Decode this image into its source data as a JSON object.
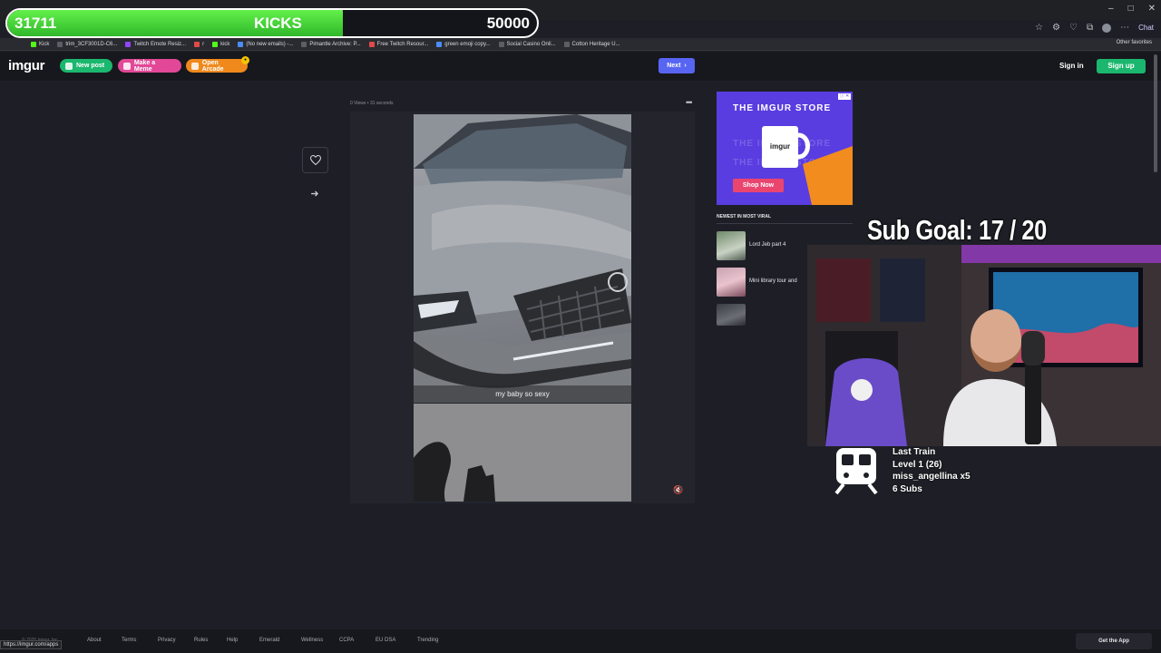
{
  "kicks_bar": {
    "count": "31711",
    "label": "KICKS",
    "goal": "50000",
    "progress": 0.634
  },
  "browser": {
    "window_controls": [
      "–",
      "□",
      "✕"
    ],
    "chat_label": "Chat",
    "bookmarks": [
      {
        "label": "Kick",
        "icon": "kick-icon"
      },
      {
        "label": "trim_3CF3001D-C6...",
        "icon": "page-icon"
      },
      {
        "label": "Twitch Emote Resiz...",
        "icon": "page-icon"
      },
      {
        "label": "r",
        "icon": "reddit-icon"
      },
      {
        "label": "kick",
        "icon": "kick-icon"
      },
      {
        "label": "(No new emails) -...",
        "icon": "mail-icon"
      },
      {
        "label": "Pimantle Archive: P...",
        "icon": "page-icon"
      },
      {
        "label": "Free Twitch Resour...",
        "icon": "page-icon"
      },
      {
        "label": "green emoji copy...",
        "icon": "page-icon"
      },
      {
        "label": "Social Casino Onli...",
        "icon": "page-icon"
      },
      {
        "label": "Cotton Heritage U...",
        "icon": "page-icon"
      }
    ],
    "other_favorites": "Other favorites",
    "status_url": "https://imgur.com/apps"
  },
  "header": {
    "logo": "imgur",
    "new_post": "New post",
    "make_meme": "Make a Meme",
    "open_arcade": "Open Arcade",
    "next": "Next",
    "sign_in": "Sign in",
    "sign_up": "Sign up"
  },
  "post": {
    "meta": "0 Views • 31 seconds",
    "caption": "my baby so sexy"
  },
  "sidebar": {
    "ad": {
      "title": "THE IMGUR STORE",
      "mug_text": "imgur",
      "shop_label": "Shop Now",
      "badge": "ⓘ ✕"
    },
    "viral_title": "NEWEST IN MOST VIRAL",
    "viral_items": [
      {
        "label": "Lord Jeb part 4"
      },
      {
        "label": "Mini library tour and"
      },
      {
        "label": ""
      }
    ]
  },
  "stream": {
    "sub_goal": "Sub Goal:  17 / 20",
    "train_title": "Last Train",
    "train_level": "Level 1  (26)",
    "train_user": "miss_angellina x5",
    "train_subs": "6 Subs"
  },
  "footer": {
    "copyright": "© 2025 Imgur, Inc",
    "links": [
      "About",
      "Terms",
      "Privacy",
      "Rules",
      "Help",
      "Emerald",
      "Wellness",
      "CCPA",
      "EU DSA",
      "Trending"
    ],
    "get_app": "Get the App"
  },
  "colors": {
    "kick_green": "#53fc18",
    "imgur_green": "#1bb76e",
    "next_blue": "#5865f2",
    "ad_purple": "#5a3de0"
  }
}
